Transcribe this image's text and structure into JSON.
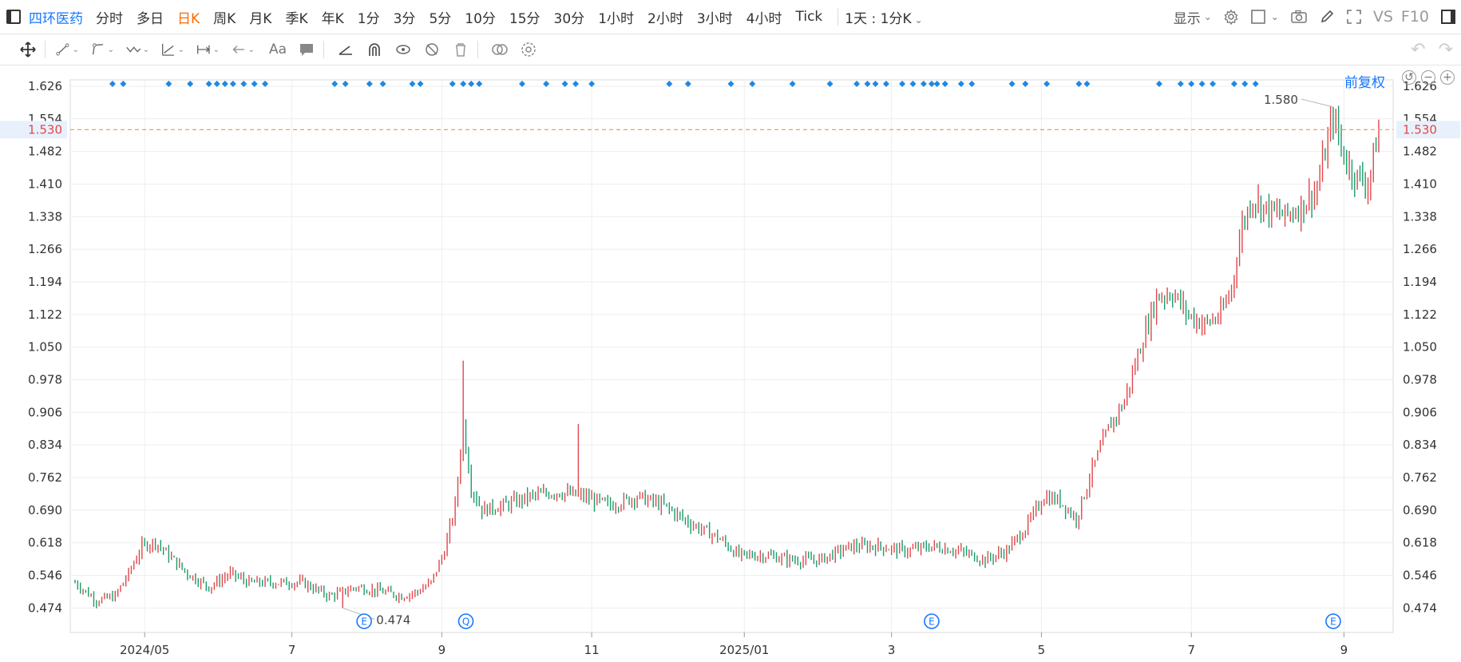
{
  "top": {
    "stock_name": "四环医药",
    "periods": [
      "分时",
      "多日",
      "日K",
      "周K",
      "月K",
      "季K",
      "年K",
      "1分",
      "3分",
      "5分",
      "10分",
      "15分",
      "30分",
      "1小时",
      "2小时",
      "3小时",
      "4小时",
      "Tick"
    ],
    "active_period": "日K",
    "range_selector": "1天 : 1分K",
    "display_label": "显示",
    "vs_label": "VS",
    "f10_label": "F10"
  },
  "chart": {
    "fuquan_label": "前复权",
    "zoom_out": "−",
    "zoom_in": "+",
    "current_price_label": "1.530",
    "high_label": "1.580",
    "low_label": "0.474",
    "colors": {
      "up": "#e0474c",
      "down": "#1a9c6a",
      "grid": "#eeeeee",
      "accent": "#1677ff",
      "marker": "#1e88e5",
      "dash": "#f0a050"
    }
  },
  "chart_data": {
    "type": "candlestick",
    "ylim": [
      0.42,
      1.64
    ],
    "y_ticks": [
      "1.626",
      "1.554",
      "1.482",
      "1.410",
      "1.338",
      "1.266",
      "1.194",
      "1.122",
      "1.050",
      "0.978",
      "0.906",
      "0.834",
      "0.762",
      "0.690",
      "0.618",
      "0.546",
      "0.474"
    ],
    "x_ticks": [
      "2024/05",
      "7",
      "9",
      "11",
      "2025/01",
      "3",
      "5",
      "7",
      "9"
    ],
    "current_price": 1.53,
    "high": 1.58,
    "low": 0.474,
    "event_badges": [
      "E",
      "Q",
      "E",
      "E"
    ],
    "trend_points": [
      [
        0,
        0.53
      ],
      [
        8,
        0.49
      ],
      [
        15,
        0.5
      ],
      [
        20,
        0.55
      ],
      [
        25,
        0.61
      ],
      [
        30,
        0.62
      ],
      [
        35,
        0.59
      ],
      [
        42,
        0.55
      ],
      [
        50,
        0.52
      ],
      [
        58,
        0.55
      ],
      [
        65,
        0.53
      ],
      [
        75,
        0.53
      ],
      [
        85,
        0.53
      ],
      [
        95,
        0.5
      ],
      [
        105,
        0.52
      ],
      [
        115,
        0.51
      ],
      [
        122,
        0.5
      ],
      [
        128,
        0.51
      ],
      [
        133,
        0.53
      ],
      [
        138,
        0.6
      ],
      [
        142,
        0.7
      ],
      [
        145,
        0.88
      ],
      [
        148,
        0.74
      ],
      [
        152,
        0.69
      ],
      [
        160,
        0.7
      ],
      [
        170,
        0.72
      ],
      [
        180,
        0.73
      ],
      [
        190,
        0.72
      ],
      [
        200,
        0.7
      ],
      [
        210,
        0.72
      ],
      [
        220,
        0.7
      ],
      [
        230,
        0.66
      ],
      [
        240,
        0.63
      ],
      [
        248,
        0.59
      ],
      [
        258,
        0.59
      ],
      [
        268,
        0.58
      ],
      [
        278,
        0.58
      ],
      [
        290,
        0.61
      ],
      [
        300,
        0.61
      ],
      [
        310,
        0.6
      ],
      [
        320,
        0.61
      ],
      [
        330,
        0.6
      ],
      [
        340,
        0.58
      ],
      [
        348,
        0.6
      ],
      [
        355,
        0.65
      ],
      [
        362,
        0.72
      ],
      [
        368,
        0.71
      ],
      [
        374,
        0.67
      ],
      [
        380,
        0.78
      ],
      [
        386,
        0.87
      ],
      [
        392,
        0.93
      ],
      [
        398,
        1.05
      ],
      [
        404,
        1.16
      ],
      [
        410,
        1.17
      ],
      [
        416,
        1.12
      ],
      [
        422,
        1.1
      ],
      [
        428,
        1.12
      ],
      [
        432,
        1.18
      ],
      [
        436,
        1.32
      ],
      [
        440,
        1.38
      ],
      [
        446,
        1.35
      ],
      [
        452,
        1.34
      ],
      [
        458,
        1.36
      ],
      [
        464,
        1.4
      ],
      [
        470,
        1.56
      ],
      [
        474,
        1.47
      ],
      [
        478,
        1.43
      ],
      [
        483,
        1.41
      ],
      [
        487,
        1.53
      ]
    ]
  }
}
